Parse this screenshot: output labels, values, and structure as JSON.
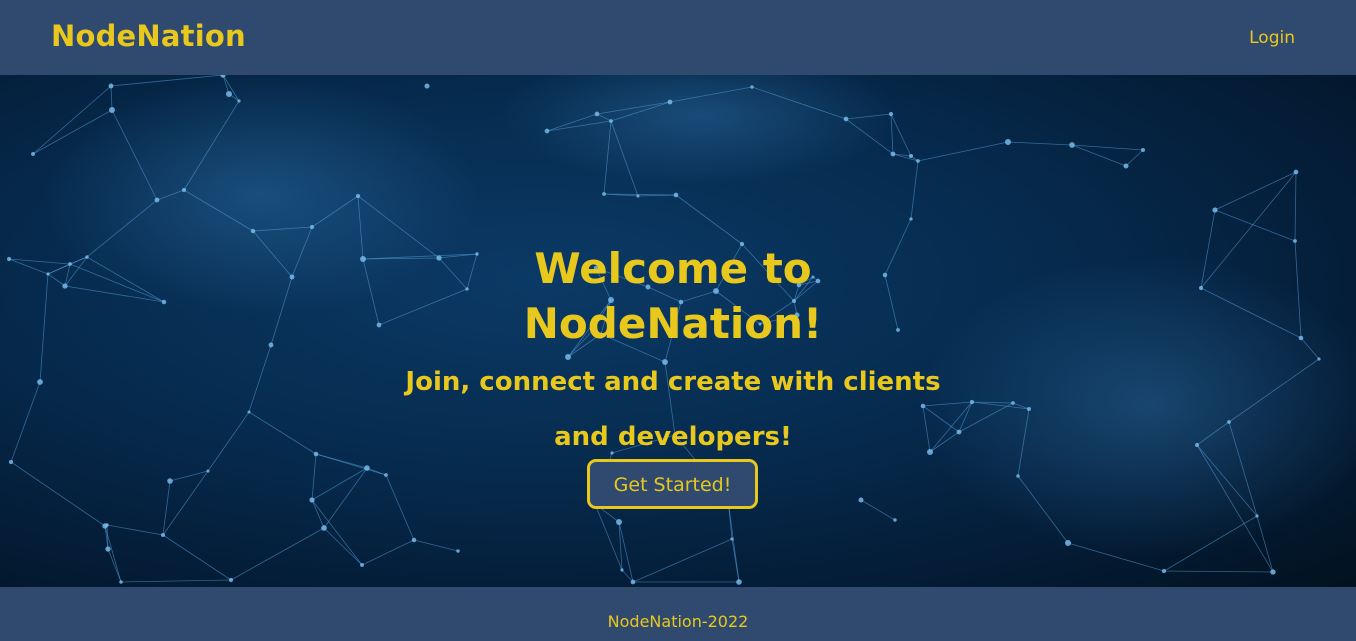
{
  "navbar": {
    "brand": "NodeNation",
    "login_label": "Login"
  },
  "hero": {
    "title": "Welcome to NodeNation!",
    "subtitle": "Join, connect and create with clients and developers!",
    "cta_label": "Get Started!"
  },
  "footer": {
    "text": "NodeNation-2022"
  },
  "colors": {
    "nav_bg": "#2f4a6e",
    "accent": "#e9c81e",
    "hero_dark": "#041c36",
    "network_line": "#4f95cf"
  }
}
